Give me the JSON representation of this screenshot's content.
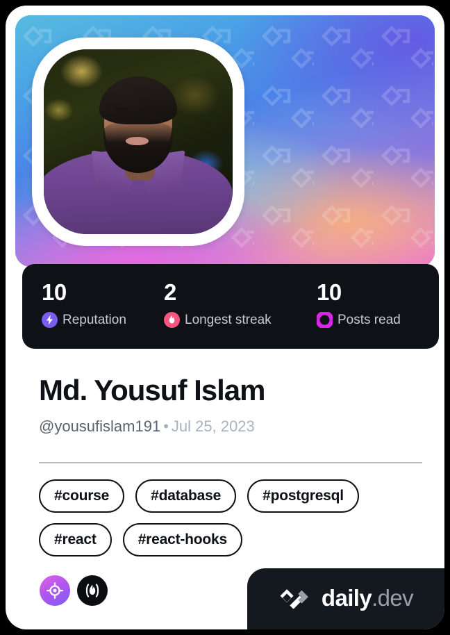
{
  "card": {
    "type": "devcard",
    "theme": {
      "page_background": "#000000",
      "card_background": "#ffffff",
      "cover_gradient_start": "#57bcdf",
      "cover_gradient_mid": "#4b84e8",
      "cover_gradient_end": "#ec6fd6",
      "stats_background": "#0e1217",
      "brand_background": "#14181f",
      "text_primary": "#0e1217",
      "text_muted": "#59636f",
      "text_faint": "#a8b3bd"
    },
    "cover": {
      "pattern_icon": "daily-dev-logo-watermark"
    },
    "avatar": {
      "alt": "profile-photo",
      "shape": "squircle",
      "border_color": "#ffffff"
    }
  },
  "stats": [
    {
      "value": "10",
      "label": "Reputation",
      "icon": "lightning-bolt-icon",
      "icon_color": "#7c5cf0"
    },
    {
      "value": "2",
      "label": "Longest streak",
      "icon": "flame-icon",
      "icon_color": "#f8557f"
    },
    {
      "value": "10",
      "label": "Posts read",
      "icon": "ring-icon",
      "icon_color": "#d726e8"
    }
  ],
  "profile": {
    "name": "Md. Yousuf Islam",
    "handle": "@yousufislam191",
    "separator": "•",
    "joined": "Jul 25, 2023"
  },
  "tags": [
    "#course",
    "#database",
    "#postgresql",
    "#react",
    "#react-hooks"
  ],
  "badges": [
    {
      "name": "top-member-badge",
      "icon": "crosshair-target-icon",
      "color": "#b056ef"
    },
    {
      "name": "streak-badge",
      "icon": "flame-in-parentheses-icon",
      "color": "#0b0d10"
    }
  ],
  "brand": {
    "mark": "daily-dev-logo-mark",
    "name": "daily",
    "suffix": ".dev"
  }
}
